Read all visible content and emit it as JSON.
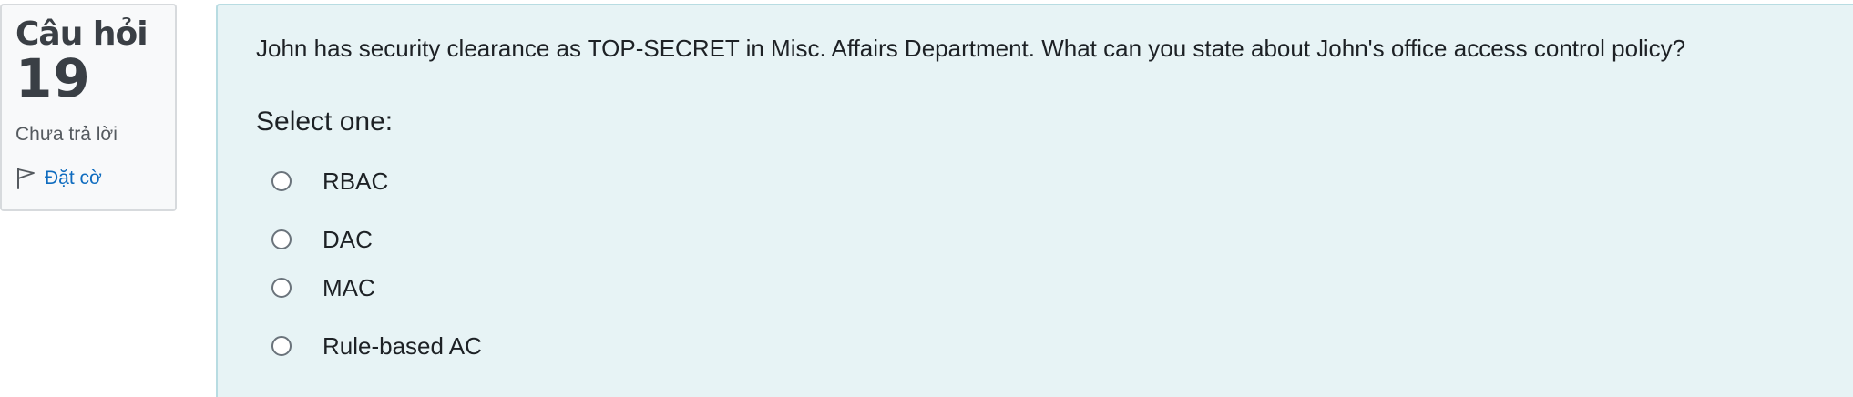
{
  "question_info": {
    "label": "Câu hỏi",
    "number": "19",
    "state": "Chưa trả lời",
    "flag_label": "Đặt cờ",
    "flag_icon": "flag-icon"
  },
  "question": {
    "text": "John has security clearance as TOP-SECRET in Misc. Affairs Department. What can you state about John's office access control policy?",
    "prompt": "Select one:",
    "options": [
      {
        "label": "RBAC",
        "selected": false
      },
      {
        "label": "DAC",
        "selected": false
      },
      {
        "label": "MAC",
        "selected": false
      },
      {
        "label": "Rule-based AC",
        "selected": false
      }
    ]
  },
  "colors": {
    "content_background": "#e7f3f5",
    "info_background": "#f8f9fa",
    "link": "#0f6cbf"
  }
}
